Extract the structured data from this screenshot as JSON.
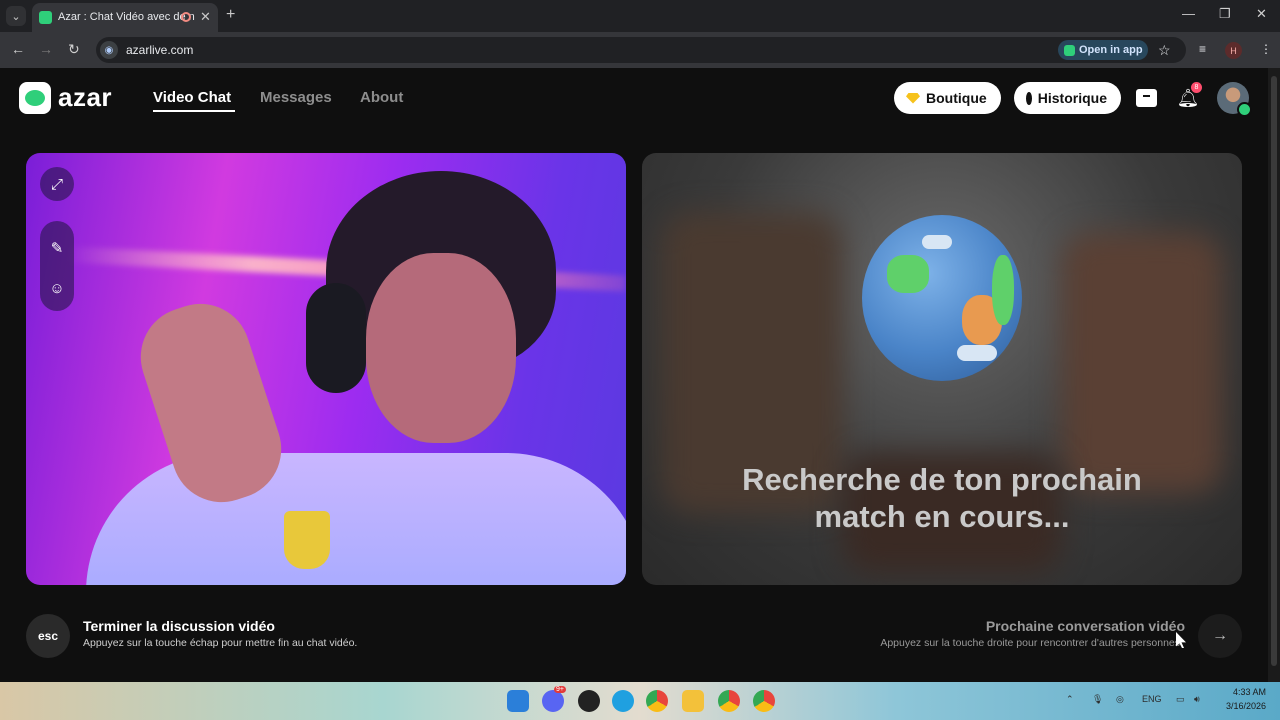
{
  "browser": {
    "tab_title": "Azar : Chat Vidéo avec de n",
    "url": "azarlive.com",
    "open_in_app_label": "Open in app",
    "profile_initial": "H"
  },
  "app": {
    "logo_text": "azar",
    "nav": [
      {
        "label": "Video Chat",
        "active": true
      },
      {
        "label": "Messages",
        "active": false
      },
      {
        "label": "About",
        "active": false
      }
    ],
    "boutique_label": "Boutique",
    "historique_label": "Historique",
    "notification_count": "8"
  },
  "search_overlay": {
    "text_line1": "Recherche de ton prochain",
    "text_line2": "match en cours..."
  },
  "controls": {
    "esc_key": "esc",
    "end_title": "Terminer la discussion vidéo",
    "end_subtitle": "Appuyez sur la touche échap pour mettre fin au chat vidéo.",
    "next_title": "Prochaine conversation vidéo",
    "next_subtitle": "Appuyez sur la touche droite pour rencontrer d'autres personnes"
  },
  "taskbar": {
    "language": "ENG",
    "time": "4:33 AM",
    "date": "3/16/2026",
    "discord_badge": "9+"
  },
  "colors": {
    "accent": "#2fcf7a",
    "background": "#0f0f0f"
  }
}
